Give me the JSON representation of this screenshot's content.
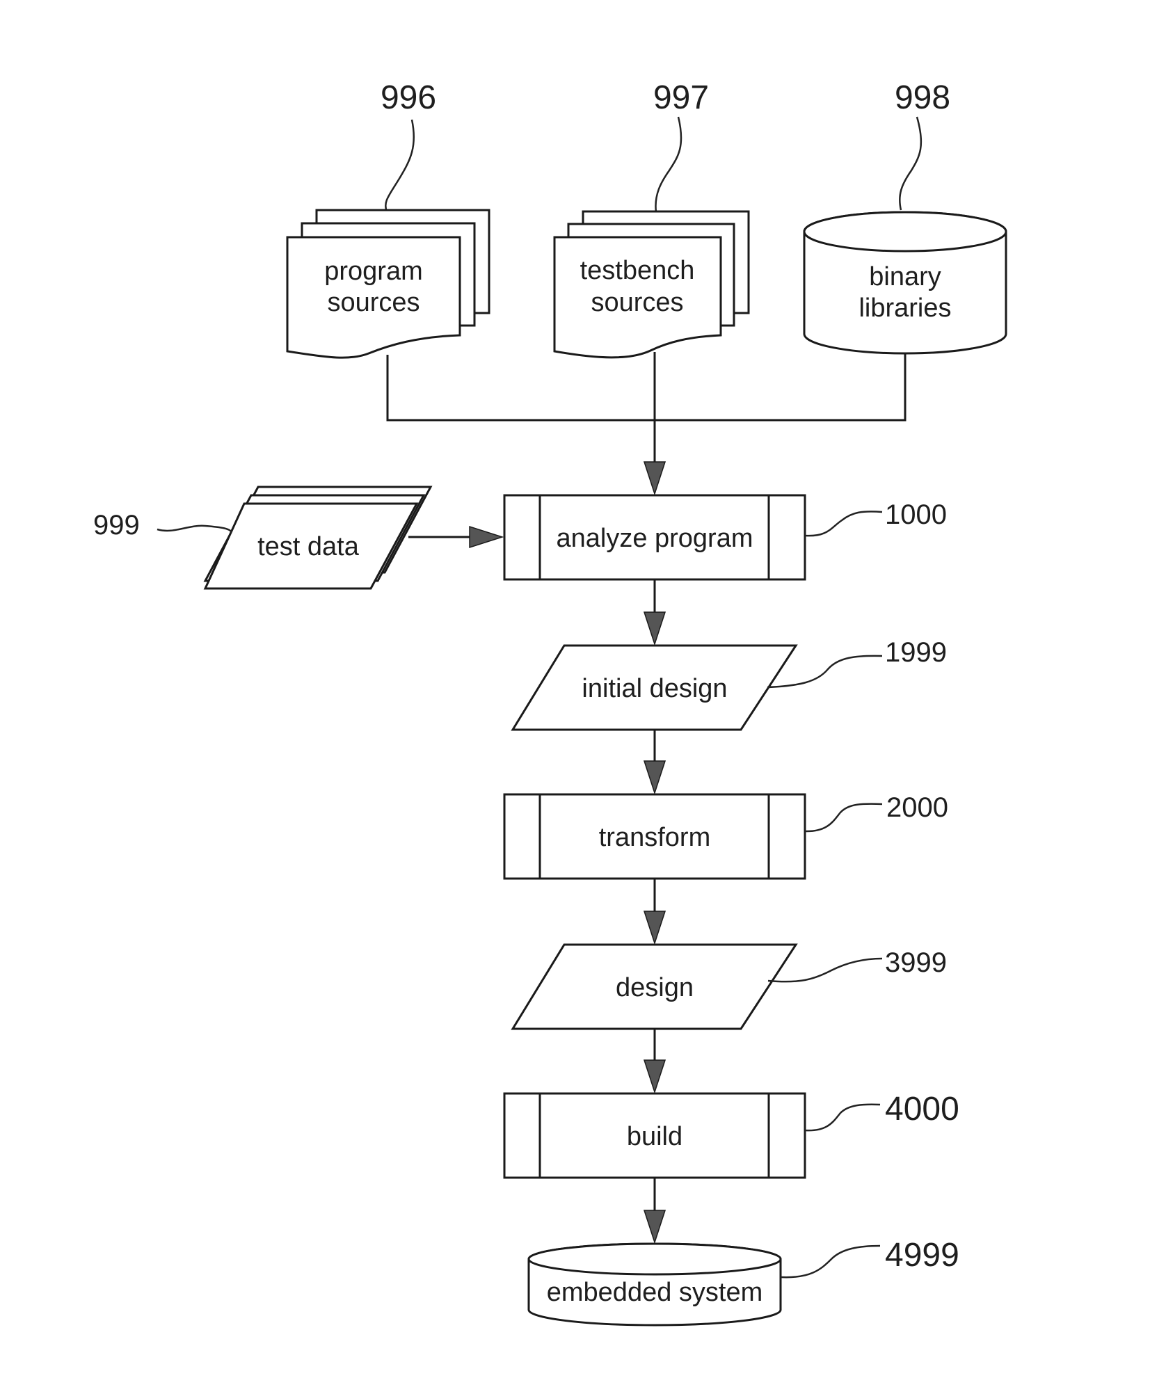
{
  "figure": {
    "nodes": {
      "program_sources": {
        "ref": "996",
        "lines": [
          "program",
          "sources"
        ],
        "shape": "multi-document"
      },
      "testbench_sources": {
        "ref": "997",
        "lines": [
          "testbench",
          "sources"
        ],
        "shape": "multi-document"
      },
      "binary_libraries": {
        "ref": "998",
        "lines": [
          "binary",
          "libraries"
        ],
        "shape": "database"
      },
      "test_data": {
        "ref": "999",
        "label": "test data",
        "shape": "multi-data"
      },
      "analyze_program": {
        "ref": "1000",
        "label": "analyze program",
        "shape": "predefined-process"
      },
      "initial_design": {
        "ref": "1999",
        "label": "initial design",
        "shape": "data"
      },
      "transform": {
        "ref": "2000",
        "label": "transform",
        "shape": "predefined-process"
      },
      "design": {
        "ref": "3999",
        "label": "design",
        "shape": "data"
      },
      "build": {
        "ref": "4000",
        "label": "build",
        "shape": "predefined-process"
      },
      "embedded_system": {
        "ref": "4999",
        "label": "embedded system",
        "shape": "database"
      }
    },
    "edges": [
      {
        "from": "program_sources",
        "to": "analyze_program"
      },
      {
        "from": "testbench_sources",
        "to": "analyze_program"
      },
      {
        "from": "binary_libraries",
        "to": "analyze_program"
      },
      {
        "from": "test_data",
        "to": "analyze_program"
      },
      {
        "from": "analyze_program",
        "to": "initial_design"
      },
      {
        "from": "initial_design",
        "to": "transform"
      },
      {
        "from": "transform",
        "to": "design"
      },
      {
        "from": "design",
        "to": "build"
      },
      {
        "from": "build",
        "to": "embedded_system"
      }
    ]
  }
}
